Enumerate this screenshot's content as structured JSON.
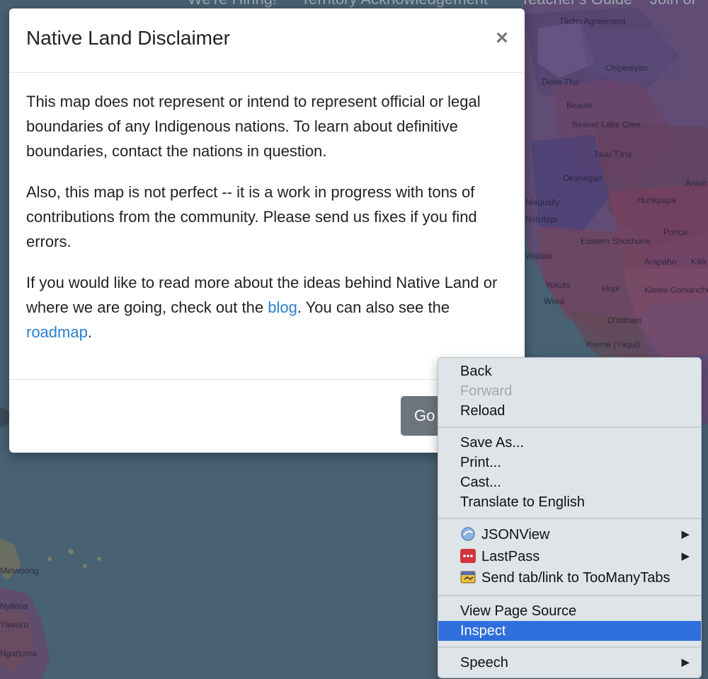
{
  "nav": {
    "items": [
      "We're Hiring!",
      "Territory Acknowledgement",
      "Teacher's Guide",
      "Join or"
    ]
  },
  "map": {
    "labels": [
      "Tlicho Agreement",
      "Chipewyan",
      "Dene Tha'",
      "Beaver",
      "Beaver Lake Cree",
      "Okanagan",
      "Tsuu T'ina",
      "Nisqually",
      "Niitsitapi",
      "Hunkpapa",
      "Ponca",
      "Eastern Shoshone",
      "Arapaho",
      "Wailaki",
      "Yokuts",
      "Hopi",
      "Kiowa-Comanche-Apache",
      "Wiwa",
      "O'odham",
      "Yoeme (Yaqui)",
      "Miriwoong",
      "Nyikina",
      "Yawuru",
      "Ngarluma",
      "Anish",
      "Kikk"
    ]
  },
  "modal": {
    "title": "Native Land Disclaimer",
    "close_glyph": "×",
    "p1": "This map does not represent or intend to represent official or legal boundaries of any Indigenous nations. To learn about definitive boundaries, contact the nations in question.",
    "p2": "Also, this map is not perfect -- it is a work in progress with tons of contributions from the community. Please send us fixes if you find errors.",
    "p3_before": "If you would like to read more about the ideas behind Native Land or where we are going, check out the ",
    "p3_link1": "blog",
    "p3_middle": ". You can also see the ",
    "p3_link2": "roadmap",
    "p3_after": ".",
    "button_label": "Go"
  },
  "context_menu": {
    "back": "Back",
    "forward": "Forward",
    "reload": "Reload",
    "save_as": "Save As...",
    "print": "Print...",
    "cast": "Cast...",
    "translate": "Translate to English",
    "jsonview": "JSONView",
    "lastpass": "LastPass",
    "toomanytabs": "Send tab/link to TooManyTabs",
    "view_source": "View Page Source",
    "inspect": "Inspect",
    "speech": "Speech",
    "submenu_arrow": "▶"
  },
  "colors": {
    "link": "#2a7fd3",
    "selection": "#2f6fdd",
    "button": "#6c757d",
    "ocean": "#5a7689"
  }
}
